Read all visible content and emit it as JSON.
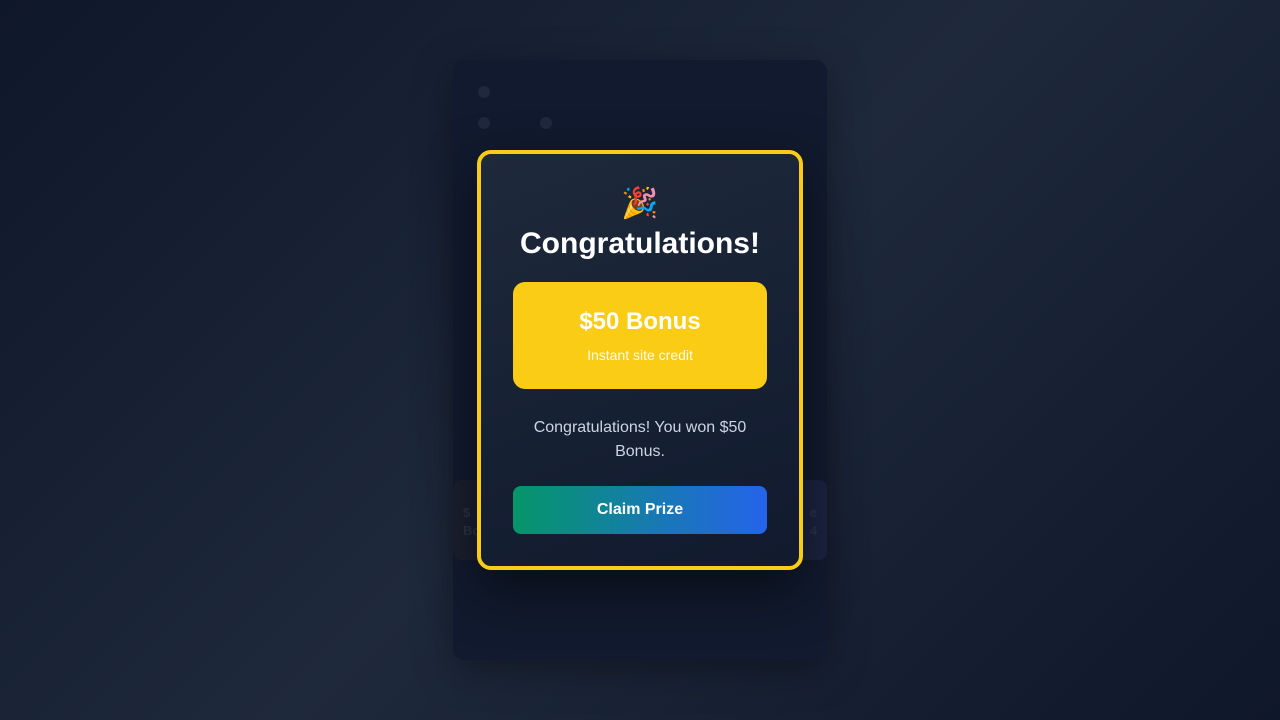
{
  "background_card": {
    "tile_left": "$\nBo",
    "tile_right": "e\n4"
  },
  "modal": {
    "icon": "party-popper-icon",
    "icon_glyph": "🎉",
    "title": "Congratulations!",
    "prize": {
      "amount": "$50 Bonus",
      "subtitle": "Instant site credit"
    },
    "message": "Congratulations! You won $50 Bonus.",
    "claim_label": "Claim Prize"
  },
  "colors": {
    "accent_border": "#facc15",
    "prize_box": "#facc15",
    "button_gradient_start": "#059669",
    "button_gradient_end": "#2563eb",
    "background": "#0f172a"
  }
}
